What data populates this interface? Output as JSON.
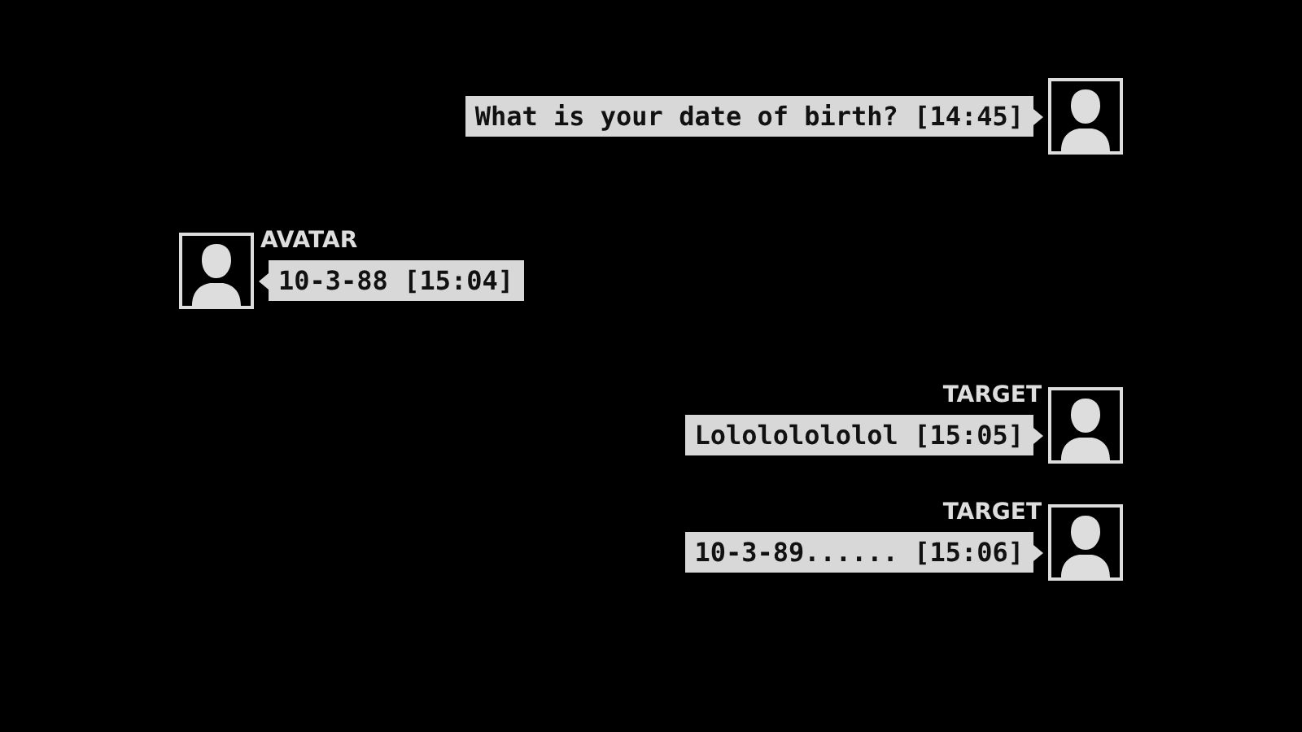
{
  "messages": [
    {
      "kind": "outgoing",
      "text": "What is your date of birth? [14:45]"
    },
    {
      "kind": "incoming",
      "sender": "AVATAR",
      "text": "10-3-88 [15:04]"
    },
    {
      "kind": "outgoing",
      "sender": "TARGET",
      "text": "Lolololololol [15:05]"
    },
    {
      "kind": "outgoing",
      "sender": "TARGET",
      "text": "10-3-89...... [15:06]"
    }
  ]
}
